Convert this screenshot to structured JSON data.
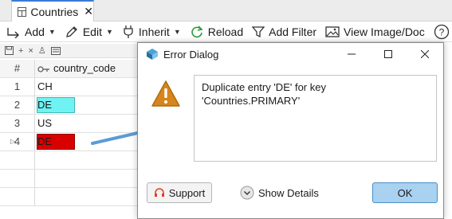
{
  "tab": {
    "label": "Countries",
    "close": "✕"
  },
  "toolbar": {
    "add": "Add",
    "edit": "Edit",
    "inherit": "Inherit",
    "reload": "Reload",
    "add_filter": "Add Filter",
    "view_image": "View Image/Doc"
  },
  "grid": {
    "header_rownum": "#",
    "column": "country_code",
    "rows": [
      {
        "num": "1",
        "value": "CH"
      },
      {
        "num": "2",
        "value": "DE"
      },
      {
        "num": "3",
        "value": "US"
      },
      {
        "num": "4",
        "value": "DE",
        "marker": "▷"
      }
    ]
  },
  "dialog": {
    "title": "Error Dialog",
    "message": "Duplicate entry 'DE' for key\n'Countries.PRIMARY'",
    "support": "Support",
    "show_details": "Show Details",
    "ok": "OK"
  },
  "colors": {
    "cell_duplicate_existing": "#6ff2f2",
    "cell_duplicate_new": "#d90000",
    "ok_button": "#a9d1f0",
    "arrow": "#5b9bd5"
  }
}
